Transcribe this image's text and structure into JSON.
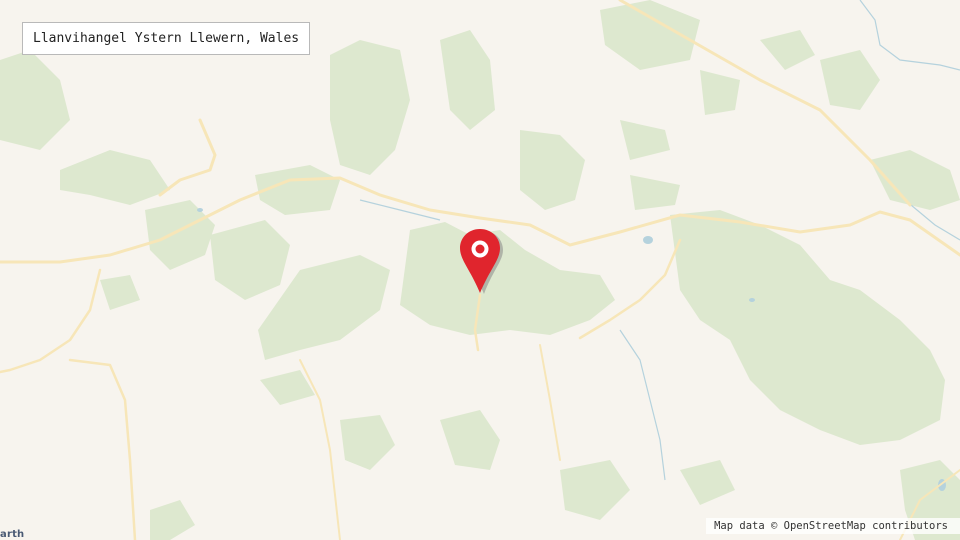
{
  "location_label": "Llanvihangel Ystern Llewern, Wales",
  "attribution": "Map data © OpenStreetMap contributors",
  "place_fragment": "arth",
  "pin_icon": "map-marker-icon",
  "colors": {
    "land": "#f7f4ee",
    "woodland": "#dde8cf",
    "road": "#f7e6b8",
    "water": "#b5d2dd",
    "pin": "#e0252d"
  }
}
